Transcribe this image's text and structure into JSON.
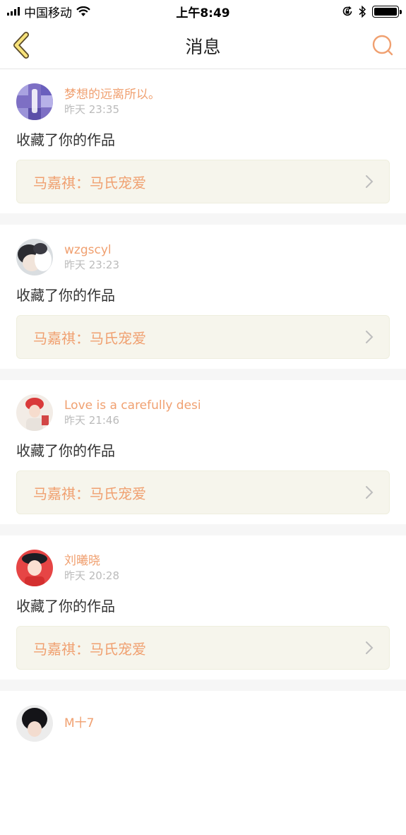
{
  "status_bar": {
    "carrier": "中国移动",
    "time": "上午8:49"
  },
  "header": {
    "title": "消息"
  },
  "notifications": [
    {
      "username": "梦想的远离所以。",
      "time": "昨天 23:35",
      "action": "收藏了你的作品",
      "work": "马嘉祺：马氏宠爱"
    },
    {
      "username": "wzgscyl",
      "time": "昨天 23:23",
      "action": "收藏了你的作品",
      "work": "马嘉祺：马氏宠爱"
    },
    {
      "username": "Love is a carefully desi",
      "time": "昨天 21:46",
      "action": "收藏了你的作品",
      "work": "马嘉祺：马氏宠爱"
    },
    {
      "username": "刘曦晓",
      "time": "昨天 20:28",
      "action": "收藏了你的作品",
      "work": "马嘉祺：马氏宠爱"
    },
    {
      "username": "M十7",
      "time": "",
      "action": "",
      "work": ""
    }
  ],
  "colors": {
    "accent": "#f0a070",
    "link_bg": "#f6f5ec",
    "separator": "#f6f6f6"
  }
}
